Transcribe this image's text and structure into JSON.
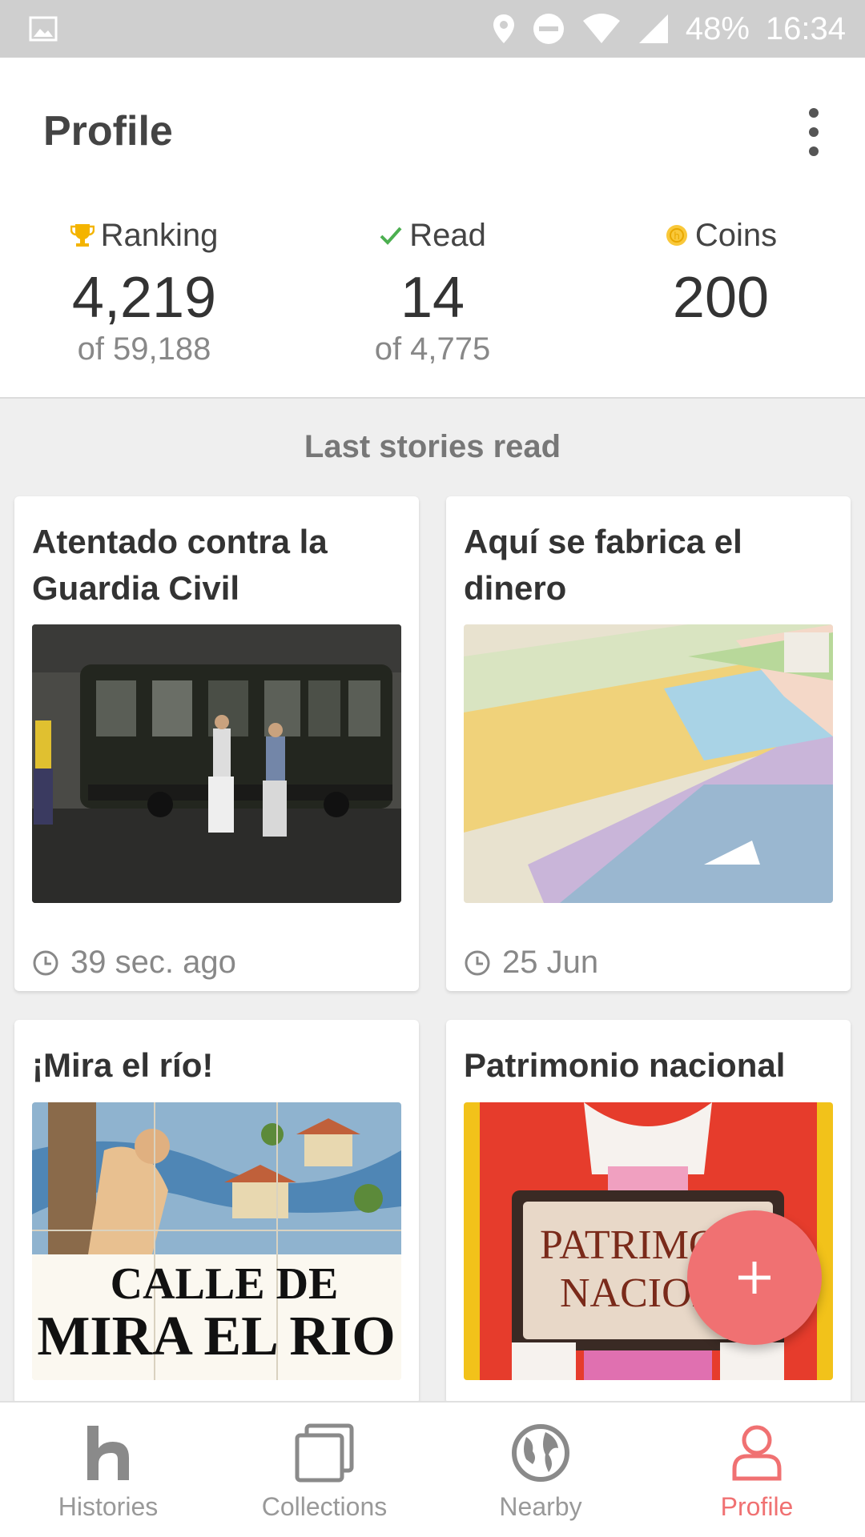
{
  "status_bar": {
    "battery": "48%",
    "time": "16:34"
  },
  "app_bar": {
    "title": "Profile"
  },
  "stats": {
    "ranking": {
      "label": "Ranking",
      "value": "4,219",
      "sub": "of 59,188"
    },
    "read": {
      "label": "Read",
      "value": "14",
      "sub": "of 4,775"
    },
    "coins": {
      "label": "Coins",
      "value": "200"
    }
  },
  "section": {
    "title": "Last stories read"
  },
  "stories": [
    {
      "title": "Atentado contra la Guardia Civil",
      "time": "39 sec. ago"
    },
    {
      "title": "Aquí se fabrica el dinero",
      "time": "25 Jun"
    },
    {
      "title": "¡Mira el río!",
      "tile_line1": "CALLE DE",
      "tile_line2": "MIRA EL RIO"
    },
    {
      "title": "Patrimonio nacional",
      "sign_line1": "PATRIMO",
      "sign_line2": "NACION"
    }
  ],
  "bottom_nav": [
    {
      "label": "Histories",
      "icon": "histories-icon"
    },
    {
      "label": "Collections",
      "icon": "collections-icon"
    },
    {
      "label": "Nearby",
      "icon": "globe-icon"
    },
    {
      "label": "Profile",
      "icon": "user-icon",
      "active": true
    }
  ],
  "colors": {
    "accent": "#f07172",
    "trophy": "#f4b400",
    "check": "#4caf50",
    "coin": "#f9c83a"
  }
}
